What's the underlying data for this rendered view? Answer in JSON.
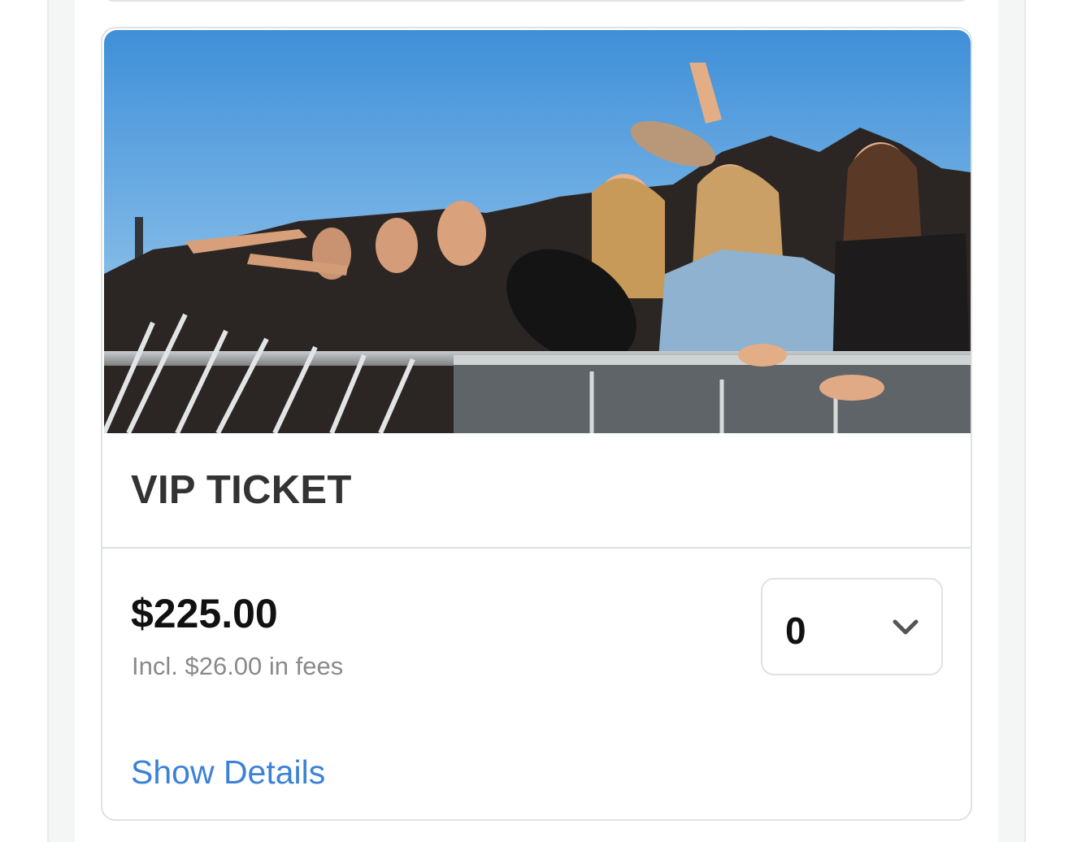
{
  "ticket": {
    "title": "VIP TICKET",
    "image_alt": "Concert crowd at barricade",
    "price": "$225.00",
    "fees_note": "Incl. $26.00 in fees",
    "quantity": "0",
    "show_details_label": "Show Details"
  },
  "icons": {
    "quantity_dropdown": "chevron-down-icon"
  },
  "colors": {
    "link": "#3b82d6",
    "title": "#333333",
    "fees": "#8a8a8a",
    "card_border": "#dfe2e2"
  }
}
